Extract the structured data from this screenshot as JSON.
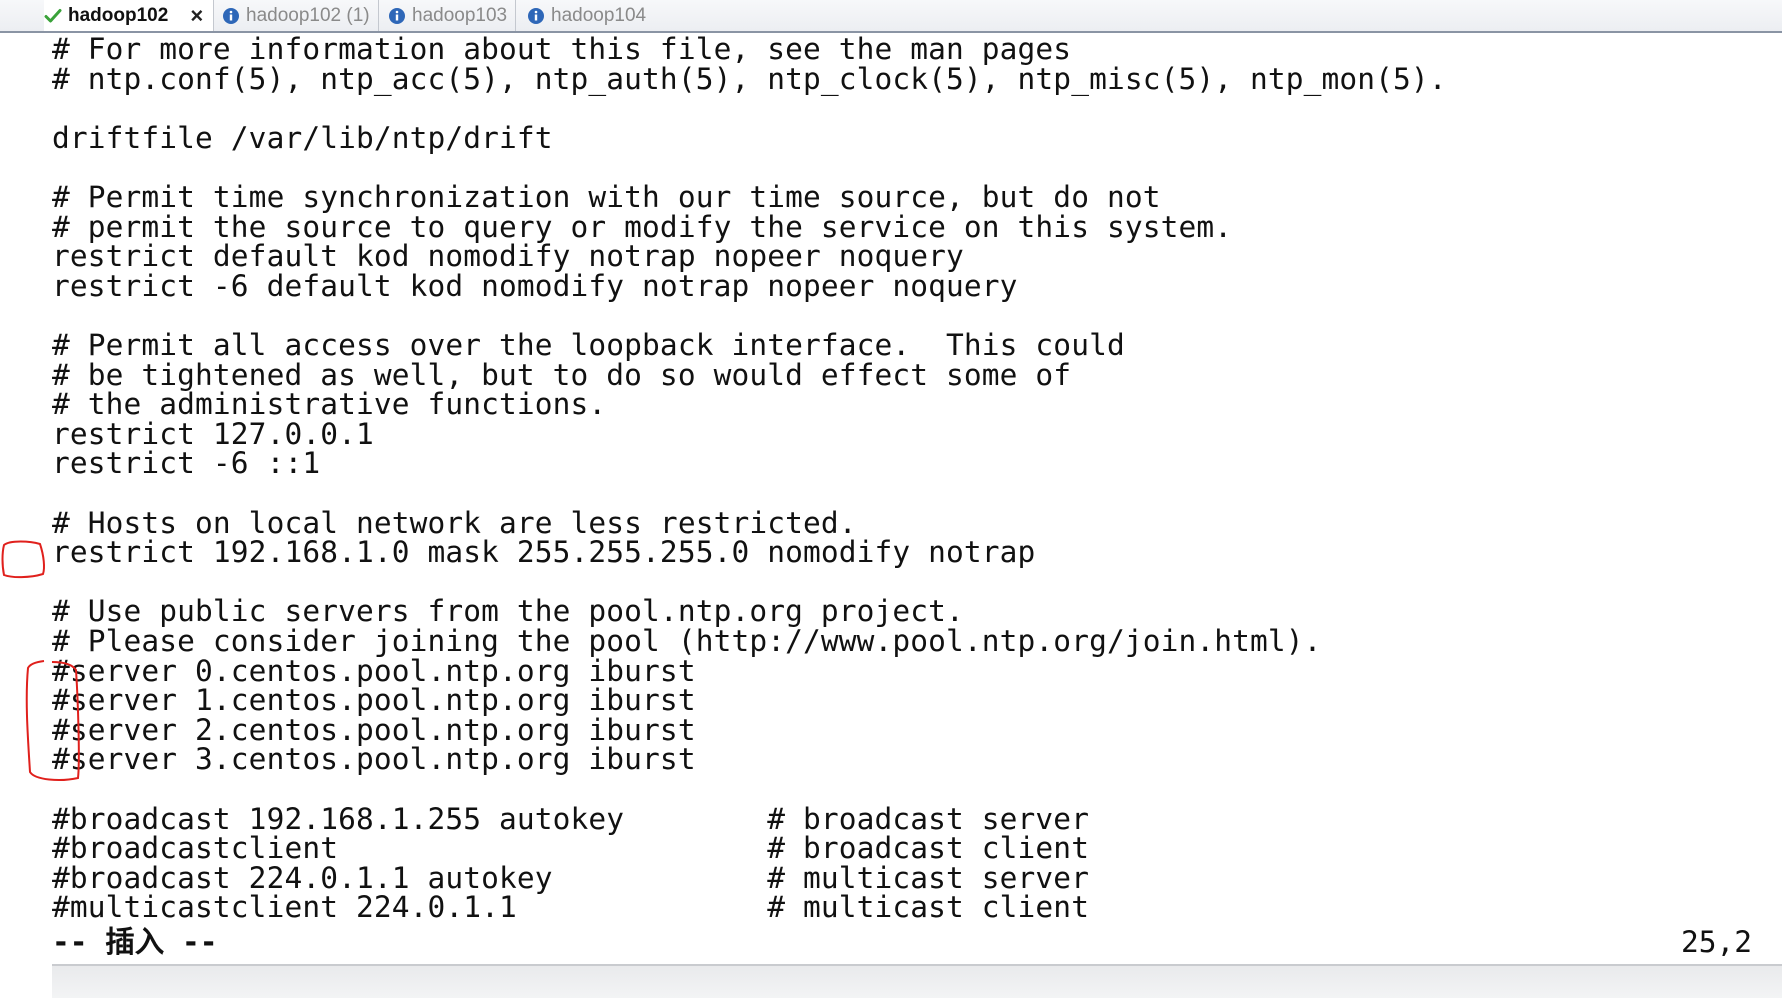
{
  "tabs": [
    {
      "label": "hadoop102",
      "status_icon": "check-icon",
      "active": true,
      "close": "×"
    },
    {
      "label": "hadoop102 (1)",
      "status_icon": "info-icon",
      "active": false
    },
    {
      "label": "hadoop103",
      "status_icon": "info-icon",
      "active": false
    },
    {
      "label": "hadoop104",
      "status_icon": "info-icon",
      "active": false
    }
  ],
  "terminal": {
    "lines": [
      "# For more information about this file, see the man pages",
      "# ntp.conf(5), ntp_acc(5), ntp_auth(5), ntp_clock(5), ntp_misc(5), ntp_mon(5).",
      "",
      "driftfile /var/lib/ntp/drift",
      "",
      "# Permit time synchronization with our time source, but do not",
      "# permit the source to query or modify the service on this system.",
      "restrict default kod nomodify notrap nopeer noquery",
      "restrict -6 default kod nomodify notrap nopeer noquery",
      "",
      "# Permit all access over the loopback interface.  This could",
      "# be tightened as well, but to do so would effect some of",
      "# the administrative functions.",
      "restrict 127.0.0.1",
      "restrict -6 ::1",
      "",
      "# Hosts on local network are less restricted.",
      "restrict 192.168.1.0 mask 255.255.255.0 nomodify notrap",
      "",
      "# Use public servers from the pool.ntp.org project.",
      "# Please consider joining the pool (http://www.pool.ntp.org/join.html).",
      "#server 0.centos.pool.ntp.org iburst",
      "#server 1.centos.pool.ntp.org iburst",
      "#server 2.centos.pool.ntp.org iburst",
      "#server 3.centos.pool.ntp.org iburst",
      "",
      "#broadcast 192.168.1.255 autokey        # broadcast server",
      "#broadcastclient                        # broadcast client",
      "#broadcast 224.0.1.1 autokey            # multicast server",
      "#multicastclient 224.0.1.1              # multicast client"
    ],
    "mode_line": "-- 插入 --",
    "cursor_position": "25,2"
  },
  "colors": {
    "annotation": "#e0201c",
    "tab_check": "#3aa23a",
    "tab_info": "#2e67b8"
  }
}
